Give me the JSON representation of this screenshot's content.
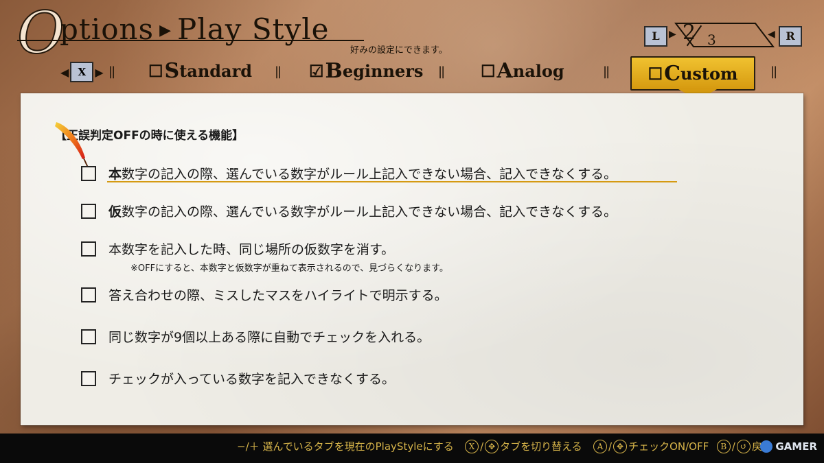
{
  "header": {
    "title_big": "O",
    "title_rest": "ptions",
    "title_arrow": "▶",
    "title_section": "Play Style",
    "subtitle": "好みの設定にできます。"
  },
  "pager": {
    "left_key": "L",
    "right_key": "R",
    "current": "2",
    "total": "3"
  },
  "tabs": {
    "switch_key": "X",
    "items": [
      {
        "checkbox": "☐",
        "cap": "S",
        "rest": "tandard"
      },
      {
        "checkbox": "☑",
        "cap": "B",
        "rest": "eginners"
      },
      {
        "checkbox": "☐",
        "cap": "A",
        "rest": "nalog"
      },
      {
        "checkbox": "☐",
        "cap": "C",
        "rest": "ustom"
      }
    ]
  },
  "panel": {
    "section_title": "【正誤判定OFFの時に使える機能】",
    "options": [
      {
        "bold": "本",
        "text": "数字の記入の際、選んでいる数字がルール上記入できない場合、記入できなくする。"
      },
      {
        "bold": "仮",
        "text": "数字の記入の際、選んでいる数字がルール上記入できない場合、記入できなくする。"
      },
      {
        "bold": "",
        "text": "本数字を記入した時、同じ場所の仮数字を消す。"
      },
      {
        "bold": "",
        "text": "答え合わせの際、ミスしたマスをハイライトで明示する。"
      },
      {
        "bold": "",
        "text": "同じ数字が9個以上ある際に自動でチェックを入れる。"
      },
      {
        "bold": "",
        "text": "チェックが入っている数字を記入できなくする。"
      }
    ],
    "note": "※OFFにすると、本数字と仮数字が重ねて表示されるので、見づらくなります。"
  },
  "footer": {
    "hint1": "−/＋ 選んでいるタブを現在のPlayStyleにする",
    "key_x": "X",
    "hint2": "タブを切り替える",
    "key_a": "A",
    "hint3": "チェックON/OFF",
    "hint4": "戻る",
    "watermark": "GAMER"
  },
  "colors": {
    "accent_tab": "#e0ac20",
    "highlight_line": "#d59a12",
    "key_badge": "#b9c2d4",
    "footer_text": "#d8b54a"
  }
}
